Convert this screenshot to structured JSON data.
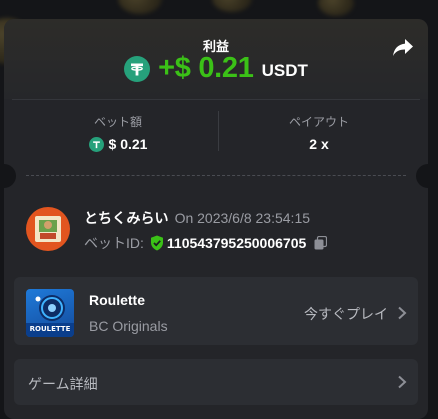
{
  "summary": {
    "profit_label": "利益",
    "profit_amount": "+$ 0.21",
    "profit_currency": "USDT"
  },
  "stats": {
    "bet_amount_label": "ベット額",
    "bet_amount_value": "$ 0.21",
    "payout_label": "ペイアウト",
    "payout_value": "2 x"
  },
  "bet": {
    "username": "とちくみらい",
    "timestamp": "On 2023/6/8 23:54:15",
    "bet_id_label": "ベットID:",
    "bet_id_value": "110543795250006705"
  },
  "game": {
    "name": "Roulette",
    "provider": "BC Originals",
    "thumb_caption": "ROULETTE",
    "play_label": "今すぐプレイ"
  },
  "details": {
    "label": "ゲーム詳細"
  },
  "icons": {
    "currency": "tether-icon",
    "share": "share-icon",
    "verified": "verified-shield-icon",
    "copy": "copy-icon",
    "chevron": "chevron-right-icon"
  },
  "colors": {
    "profit_green": "#3bc117",
    "tether_green": "#26a17b",
    "card_bg": "#242529",
    "box_bg": "#2c2e33"
  }
}
